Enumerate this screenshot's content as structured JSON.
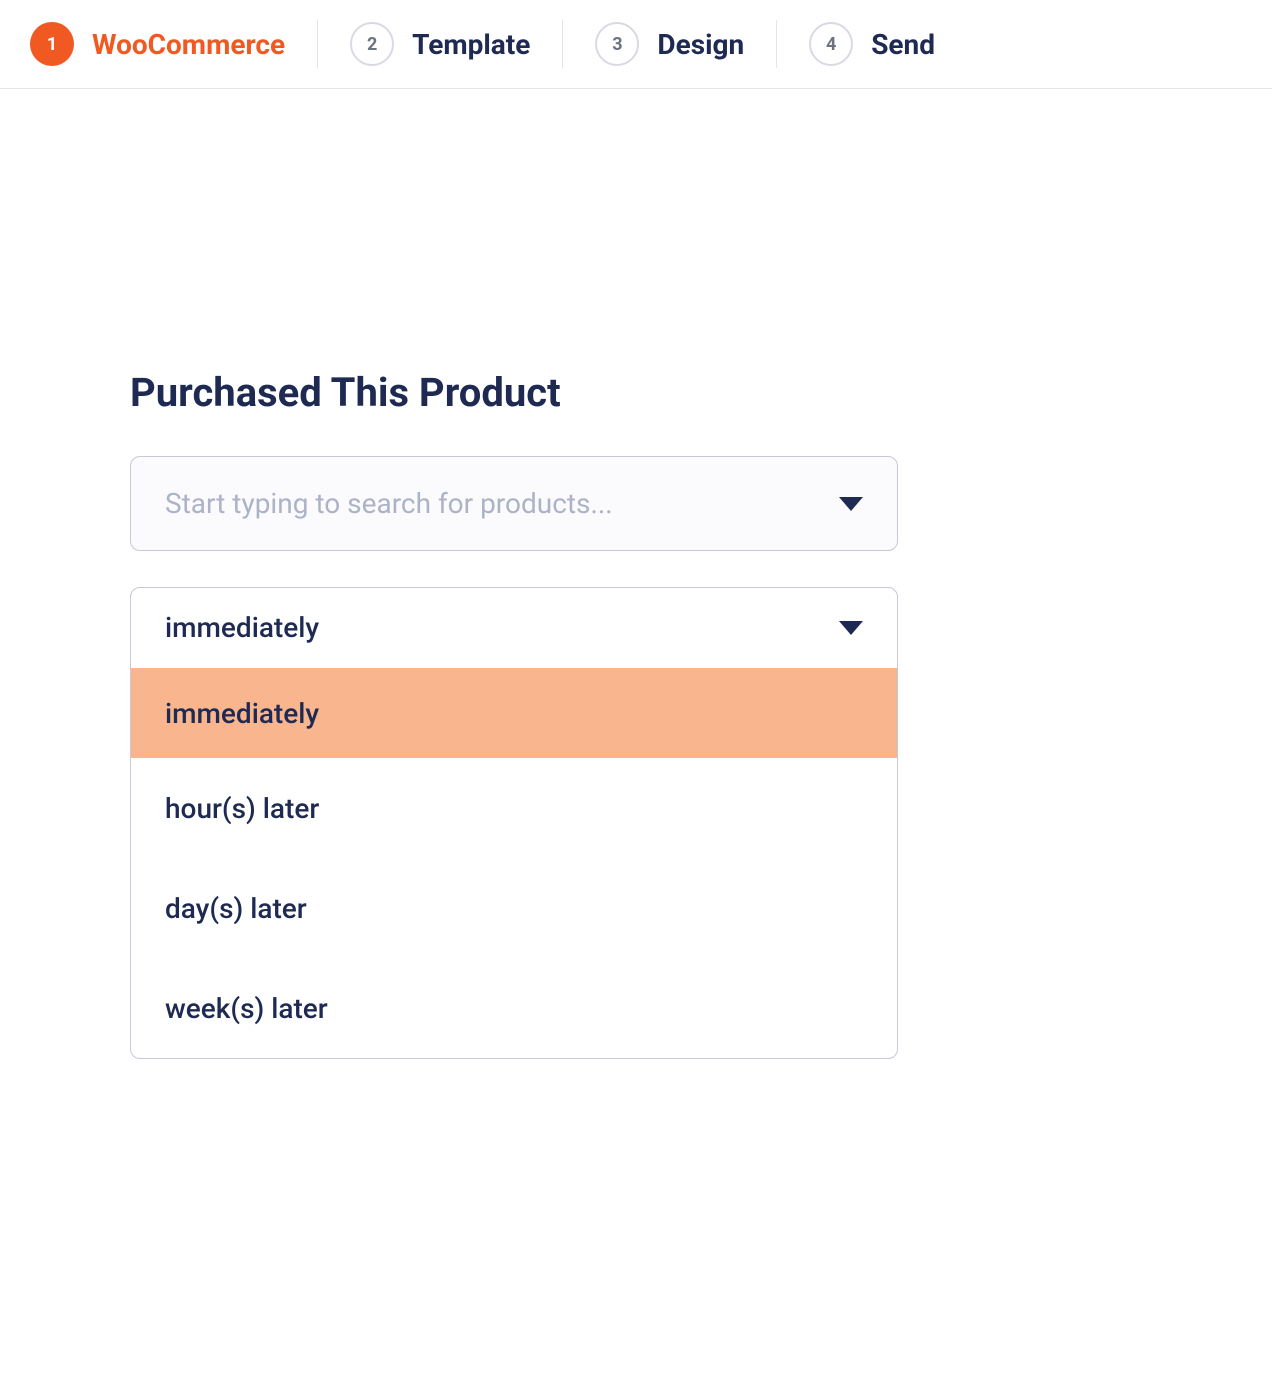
{
  "stepper": {
    "steps": [
      {
        "number": "1",
        "label": "WooCommerce",
        "active": true
      },
      {
        "number": "2",
        "label": "Template",
        "active": false
      },
      {
        "number": "3",
        "label": "Design",
        "active": false
      },
      {
        "number": "4",
        "label": "Send",
        "active": false
      }
    ]
  },
  "section": {
    "title": "Purchased This Product"
  },
  "search": {
    "placeholder": "Start typing to search for products..."
  },
  "dropdown": {
    "selected": "immediately",
    "options": [
      {
        "label": "immediately",
        "highlighted": true
      },
      {
        "label": "hour(s) later",
        "highlighted": false
      },
      {
        "label": "day(s) later",
        "highlighted": false
      },
      {
        "label": "week(s) later",
        "highlighted": false
      }
    ]
  }
}
